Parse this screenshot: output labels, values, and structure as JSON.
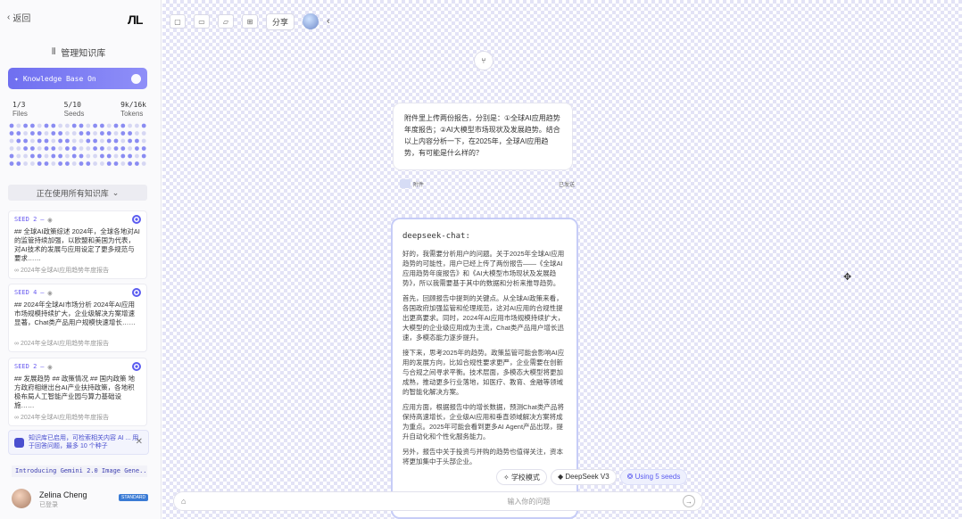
{
  "sidebar": {
    "back_label": "返回",
    "logo": "ЛL",
    "manage_label": "管理知识库",
    "kb_toggle_label": "Knowledge Base On",
    "stats": [
      {
        "num": "1/3",
        "label": "Files"
      },
      {
        "num": "5/10",
        "label": "Seeds"
      },
      {
        "num": "9k/16k",
        "label": "Tokens"
      }
    ],
    "using_all_label": "正在使用所有知识库",
    "seeds": [
      {
        "tag": "SEED 2",
        "body": "## 全球AI政策综述 2024年，全球各地对AI的监管持续加强，以欧盟和美国为代表，对AI技术的发展与应用设定了更多规范与要求……",
        "source": "2024年全球AI应用趋势年度报告"
      },
      {
        "tag": "SEED 4",
        "body": "## 2024年全球AI市场分析 2024年AI应用市场规模持续扩大，企业级解决方案增速显著，Chat类产品用户规模快速增长……",
        "source": "2024年全球AI应用趋势年度报告"
      },
      {
        "tag": "SEED 2",
        "body": "## 发展趋势 ## 政策情况 ## 国内政策 地方政府相继出台AI产业扶持政策，各地积极布局人工智能产业园与算力基础设施……",
        "source": "2024年全球AI应用趋势年度报告"
      }
    ],
    "notice_text": "知识库已启用，可检索相关内容 AI ... 用于回答问题，最多 10 个种子",
    "banner_text": "Introducing Gemini 2.0 Image Gene...",
    "user": {
      "name": "Zelina Cheng",
      "role": "已登录",
      "badge": "STANDARD"
    }
  },
  "toolbar": {
    "share_label": "分享"
  },
  "question": {
    "text": "附件里上传两份报告，分别是：①全球AI应用趋势年度报告；②AI大模型市场现状及发展趋势。结合以上内容分析一下，在2025年，全球AI应用趋势，有可能是什么样的？",
    "meta_left": "附件",
    "meta_right": "已发送"
  },
  "answer": {
    "title": "deepseek-chat:",
    "paragraphs": [
      "好的，我需要分析用户的问题。关于2025年全球AI应用趋势的可能性，用户已经上传了两份报告——《全球AI应用趋势年度报告》和《AI大模型市场现状及发展趋势》，所以我需要基于其中的数据和分析来推导趋势。",
      "首先，回顾报告中提到的关键点。从全球AI政策来看，各国政府加强监管和伦理规范，这对AI应用的合规性提出更高要求。同时，2024年AI应用市场规模持续扩大，大模型的企业级应用成为主流，Chat类产品用户增长迅速，多模态能力逐步提升。",
      "接下来，思考2025年的趋势。政策监管可能会影响AI应用的发展方向，比如合规性要求更严，企业需要在创新与合规之间寻求平衡。技术层面，多模态大模型将更加成熟，推动更多行业落地，如医疗、教育、金融等领域的智能化解决方案。",
      "应用方面，根据报告中的增长数据，预测Chat类产品将保持高速增长，企业级AI应用和垂直领域解决方案将成为重点。2025年可能会看到更多AI Agent产品出现，提升自动化和个性化服务能力。",
      "另外，报告中关于投资与并购的趋势也值得关注，资本将更加集中于头部企业。"
    ]
  },
  "chips": {
    "mode": "学校模式",
    "model": "DeepSeek V3",
    "seeds": "Using 5 seeds"
  },
  "input": {
    "placeholder": "输入你的问题"
  }
}
